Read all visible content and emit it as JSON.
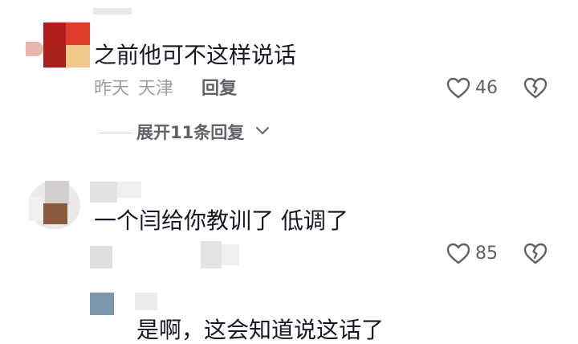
{
  "comment1": {
    "text": "之前他可不这样说话",
    "date": "昨天",
    "location": "天津",
    "reply_label": "回复",
    "likes": "46",
    "expand_label": "展开11条回复"
  },
  "comment2": {
    "text": "一个闫给你教训了 低调了",
    "likes": "85"
  },
  "reply1": {
    "text": "是啊，这会知道说这话了"
  },
  "colors": {
    "text_primary": "#161823",
    "text_secondary": "#9aa0a6",
    "icon_gray": "#5f6368"
  },
  "icons": {
    "like": "heart-outline-icon",
    "dislike": "broken-heart-icon",
    "expand": "chevron-down-icon"
  }
}
